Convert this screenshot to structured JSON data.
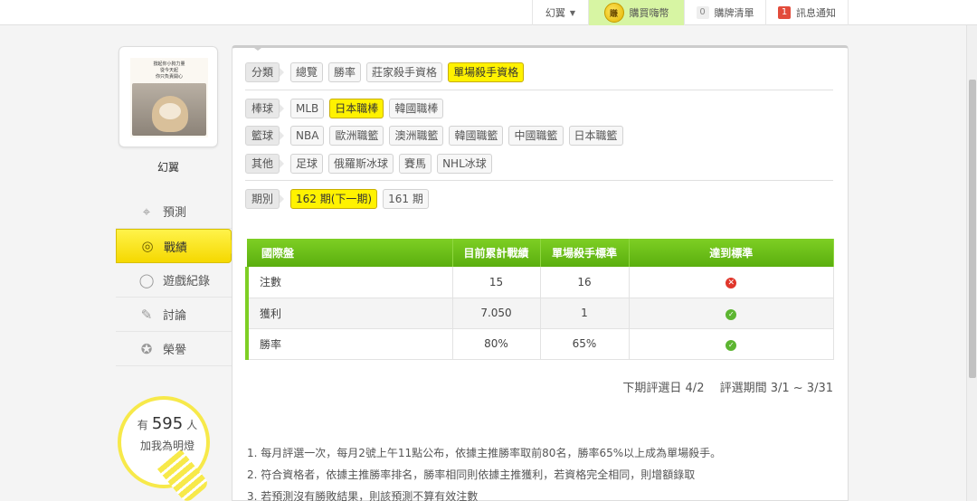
{
  "topbar": {
    "user": "幻翼",
    "coin_glyph": "賺",
    "buy": "購買嗨幣",
    "cart_count": "0",
    "cart": "購牌清單",
    "msg_count": "1",
    "msg": "訊息通知"
  },
  "sidebar": {
    "avatar_text": [
      "撐起你小狗力量",
      "從今天起",
      "你只負責開心"
    ],
    "username": "幻翼",
    "menu": [
      {
        "label": "預測",
        "icon": "crosshair-icon"
      },
      {
        "label": "戰績",
        "icon": "trophy-icon"
      },
      {
        "label": "遊戲紀錄",
        "icon": "record-icon"
      },
      {
        "label": "討論",
        "icon": "chat-icon"
      },
      {
        "label": "榮譽",
        "icon": "medal-icon"
      }
    ],
    "bulb": {
      "prefix": "有",
      "count": "595",
      "suffix": "人",
      "line2": "加我為明燈"
    }
  },
  "filters": {
    "category": {
      "label": "分類",
      "items": [
        "總覽",
        "勝率",
        "莊家殺手資格",
        "單場殺手資格"
      ],
      "selected": 3
    },
    "baseball": {
      "label": "棒球",
      "items": [
        "MLB",
        "日本職棒",
        "韓國職棒"
      ],
      "selected": 1
    },
    "basketball": {
      "label": "籃球",
      "items": [
        "NBA",
        "歐洲職籃",
        "澳洲職籃",
        "韓國職籃",
        "中國職籃",
        "日本職籃"
      ],
      "selected": -1
    },
    "other": {
      "label": "其他",
      "items": [
        "足球",
        "俄羅斯冰球",
        "賽馬",
        "NHL冰球"
      ],
      "selected": -1
    },
    "period": {
      "label": "期別",
      "items": [
        "162 期(下一期)",
        "161 期"
      ],
      "selected": 0
    }
  },
  "table": {
    "headers": [
      "國際盤",
      "目前累計戰績",
      "單場殺手標準",
      "達到標準"
    ],
    "rows": [
      {
        "name": "注數",
        "current": "15",
        "standard": "16",
        "met": false
      },
      {
        "name": "獲利",
        "current": "7.050",
        "standard": "1",
        "met": true
      },
      {
        "name": "勝率",
        "current": "80%",
        "standard": "65%",
        "met": true
      }
    ]
  },
  "period_info": "下期評選日 4/2　 評選期間 3/1 ~ 3/31",
  "notes": [
    "1. 每月評選一次，每月2號上午11點公布，依據主推勝率取前80名，勝率65%以上成為單場殺手。",
    "2. 符合資格者，依據主推勝率排名，勝率相同則依據主推獲利，若資格完全相同，則增額錄取",
    "3. 若預測沒有勝敗結果，則該預測不算有效注數"
  ],
  "colors": {
    "accent_yellow": "#fff200",
    "header_green": "#6cc01a",
    "fail_red": "#e0362b",
    "ok_green": "#5cb531"
  }
}
